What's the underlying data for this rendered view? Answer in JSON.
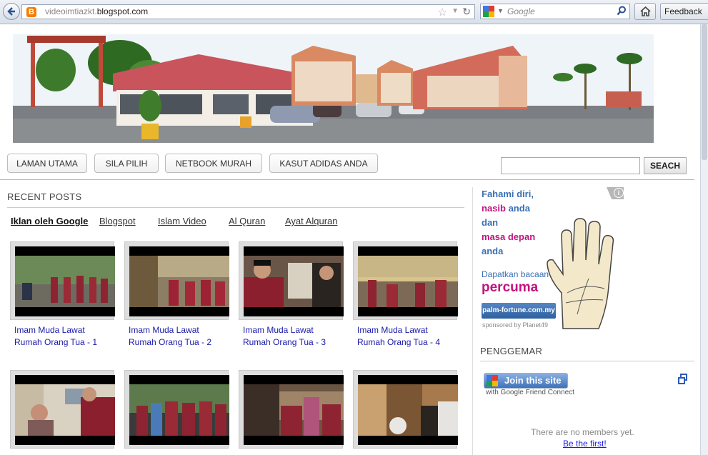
{
  "browser": {
    "url_prefix": "videoimtiazkt.",
    "url_domain": "blogspot.com",
    "favicon_letter": "B",
    "search_engine": "Google",
    "feedback_label": "Feedback"
  },
  "nav": {
    "items": [
      "LAMAN UTAMA",
      "SILA PILIH",
      "NETBOOK MURAH",
      "KASUT ADIDAS ANDA"
    ],
    "search_button": "SEACH"
  },
  "recent": {
    "title": "RECENT POSTS",
    "tabs": [
      "Iklan oleh Google",
      "Blogspot",
      "Islam Video",
      "Al Quran",
      "Ayat Alquran"
    ],
    "posts": [
      {
        "line1": "Imam Muda Lawat",
        "line2": "Rumah Orang Tua - 1"
      },
      {
        "line1": "Imam Muda Lawat",
        "line2": "Rumah Orang Tua - 2"
      },
      {
        "line1": "Imam Muda Lawat",
        "line2": "Rumah Orang Tua - 3"
      },
      {
        "line1": "Imam Muda Lawat",
        "line2": "Rumah Orang Tua - 4"
      }
    ]
  },
  "ad": {
    "line1": "Fahami diri,",
    "line2a": "nasib",
    "line2b": " anda",
    "line3": "dan",
    "line4": "masa depan",
    "line5": "anda",
    "line6": "Dapatkan bacaan",
    "line7": "percuma",
    "url_button": "palm-fortune.com.my",
    "sponsor": "sponsored by Planet49",
    "info_symbol": "i",
    "colors": {
      "blue": "#3a6fb5",
      "magenta": "#c0147f"
    }
  },
  "penggemar": {
    "title": "PENGGEMAR",
    "join_label": "Join this site",
    "gfc_sub": "with Google Friend Connect",
    "no_members": "There are no members yet.",
    "be_first": "Be the first!"
  }
}
